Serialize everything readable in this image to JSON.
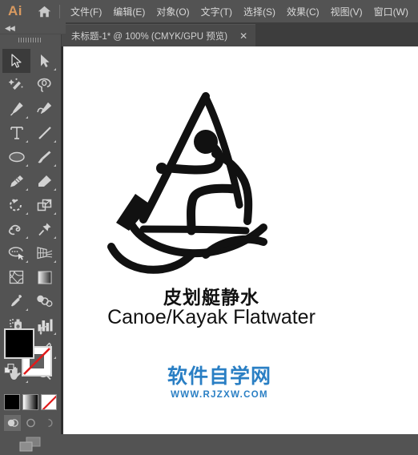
{
  "app": {
    "logo_text": "Ai",
    "logo_color": "#d99a60",
    "home_icon": "home-icon",
    "background": "#535353"
  },
  "menubar": {
    "items": [
      {
        "label": "文件(F)",
        "name": "menu-file"
      },
      {
        "label": "编辑(E)",
        "name": "menu-edit"
      },
      {
        "label": "对象(O)",
        "name": "menu-object"
      },
      {
        "label": "文字(T)",
        "name": "menu-type"
      },
      {
        "label": "选择(S)",
        "name": "menu-select"
      },
      {
        "label": "效果(C)",
        "name": "menu-effect"
      },
      {
        "label": "视图(V)",
        "name": "menu-view"
      },
      {
        "label": "窗口(W)",
        "name": "menu-window"
      }
    ]
  },
  "tabbar": {
    "document_tab": {
      "title": "未标题-1* @ 100% (CMYK/GPU 预览)",
      "close_label": "✕",
      "active": true
    }
  },
  "toolbar": {
    "collapse_label": "◀◀",
    "tools": [
      {
        "name": "selection-tool",
        "icon": "arrow-cursor-icon",
        "selected": true,
        "has_flyout": false
      },
      {
        "name": "direct-selection-tool",
        "icon": "direct-arrow-icon",
        "selected": false,
        "has_flyout": true
      },
      {
        "name": "magic-wand-tool",
        "icon": "magic-wand-icon",
        "selected": false,
        "has_flyout": false
      },
      {
        "name": "lasso-tool",
        "icon": "lasso-icon",
        "selected": false,
        "has_flyout": false
      },
      {
        "name": "pen-tool",
        "icon": "pen-icon",
        "selected": false,
        "has_flyout": true
      },
      {
        "name": "curvature-tool",
        "icon": "curvature-pen-icon",
        "selected": false,
        "has_flyout": false
      },
      {
        "name": "type-tool",
        "icon": "type-t-icon",
        "selected": false,
        "has_flyout": true
      },
      {
        "name": "line-segment-tool",
        "icon": "line-segment-icon",
        "selected": false,
        "has_flyout": true
      },
      {
        "name": "ellipse-tool",
        "icon": "ellipse-icon",
        "selected": false,
        "has_flyout": true
      },
      {
        "name": "paintbrush-tool",
        "icon": "paintbrush-icon",
        "selected": false,
        "has_flyout": true
      },
      {
        "name": "pencil-tool",
        "icon": "pencil-icon",
        "selected": false,
        "has_flyout": true
      },
      {
        "name": "eraser-tool",
        "icon": "eraser-icon",
        "selected": false,
        "has_flyout": true
      },
      {
        "name": "rotate-tool",
        "icon": "rotate-icon",
        "selected": false,
        "has_flyout": true
      },
      {
        "name": "scale-tool",
        "icon": "scale-icon",
        "selected": false,
        "has_flyout": true
      },
      {
        "name": "width-tool",
        "icon": "width-warp-icon",
        "selected": false,
        "has_flyout": true
      },
      {
        "name": "free-transform-tool",
        "icon": "pushpin-icon",
        "selected": false,
        "has_flyout": true
      },
      {
        "name": "shape-builder-tool",
        "icon": "shape-builder-icon",
        "selected": false,
        "has_flyout": true
      },
      {
        "name": "perspective-grid-tool",
        "icon": "perspective-grid-icon",
        "selected": false,
        "has_flyout": true
      },
      {
        "name": "mesh-tool",
        "icon": "mesh-icon",
        "selected": false,
        "has_flyout": false
      },
      {
        "name": "gradient-tool",
        "icon": "gradient-icon",
        "selected": false,
        "has_flyout": false
      },
      {
        "name": "eyedropper-tool",
        "icon": "eyedropper-icon",
        "selected": false,
        "has_flyout": true
      },
      {
        "name": "blend-tool",
        "icon": "blend-icon",
        "selected": false,
        "has_flyout": false
      },
      {
        "name": "symbol-sprayer-tool",
        "icon": "symbol-sprayer-icon",
        "selected": false,
        "has_flyout": true
      },
      {
        "name": "column-graph-tool",
        "icon": "column-graph-icon",
        "selected": false,
        "has_flyout": true
      },
      {
        "name": "artboard-tool",
        "icon": "artboard-icon",
        "selected": false,
        "has_flyout": false
      },
      {
        "name": "slice-tool",
        "icon": "slice-knife-icon",
        "selected": false,
        "has_flyout": true
      },
      {
        "name": "hand-tool",
        "icon": "hand-icon",
        "selected": false,
        "has_flyout": true
      },
      {
        "name": "zoom-tool",
        "icon": "magnifier-icon",
        "selected": false,
        "has_flyout": false
      }
    ],
    "color_controls": {
      "fill_name": "fill-swatch",
      "fill_color": "#000000",
      "stroke_name": "stroke-swatch",
      "stroke_color": "#ffffff",
      "stroke_is_none": true,
      "swap_icon": "swap-fill-stroke-icon",
      "default_icon": "default-fill-stroke-icon"
    },
    "mode_buttons": [
      {
        "name": "color-mode-button",
        "icon": "solid-color-icon",
        "selected": true
      },
      {
        "name": "gradient-mode-button",
        "icon": "gradient-swatch-icon",
        "selected": false
      },
      {
        "name": "none-mode-button",
        "icon": "none-slash-icon",
        "selected": false
      }
    ],
    "draw_mode_buttons": [
      {
        "name": "draw-normal-button",
        "icon": "draw-normal-icon",
        "selected": true
      },
      {
        "name": "draw-behind-button",
        "icon": "draw-behind-icon",
        "selected": false
      },
      {
        "name": "draw-inside-button",
        "icon": "draw-inside-icon",
        "selected": false
      }
    ],
    "screen_mode": {
      "name": "change-screen-mode-button",
      "icon": "screen-mode-icon"
    }
  },
  "canvas": {
    "background": "#ffffff",
    "artwork": {
      "name": "canoe-kayak-pictogram",
      "color": "#111111",
      "description": "Canoe/Kayak flatwater athlete pictogram"
    },
    "title_cn": "皮划艇静水",
    "title_en": "Canoe/Kayak Flatwater",
    "watermark": {
      "brand_cn": "软件自学网",
      "url": "WWW.RJZXW.COM",
      "color": "#2a7fc4"
    }
  }
}
